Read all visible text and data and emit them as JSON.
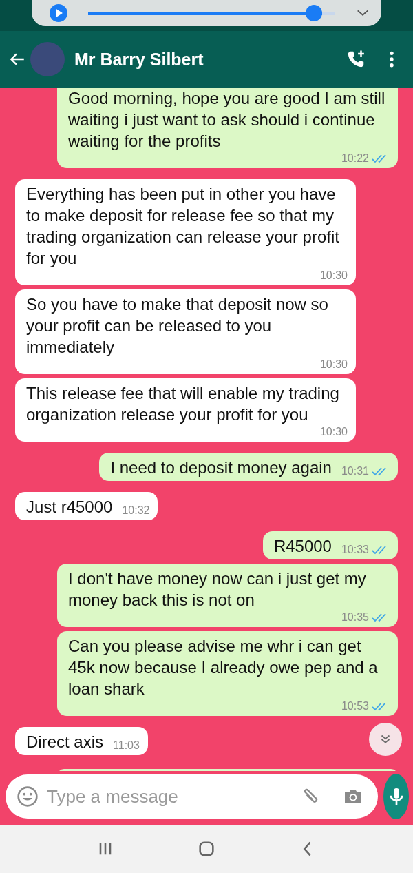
{
  "media_overlay": {
    "level": 0.95
  },
  "header": {
    "contact_name": "Mr Barry Silbert"
  },
  "messages": [
    {
      "kind": "sent",
      "text": "Good morning, hope you are good I am still waiting i just want to ask should i continue waiting for the profits",
      "time": "10:22",
      "read": true
    },
    {
      "kind": "received",
      "text": "Everything has been put in other you have to make deposit for release fee so that my trading organization can release your profit for you",
      "time": "10:30"
    },
    {
      "kind": "received",
      "text": "So you have to make that deposit now so your profit can be released to you immediately",
      "time": "10:30"
    },
    {
      "kind": "received",
      "text": "This release fee that will enable my trading organization release your profit for you",
      "time": "10:30"
    },
    {
      "kind": "sent",
      "text": "I need to deposit money again",
      "time": "10:31",
      "read": true
    },
    {
      "kind": "received",
      "text": "Just r45000",
      "time": "10:32"
    },
    {
      "kind": "sent",
      "text": "R45000",
      "time": "10:33",
      "read": true
    },
    {
      "kind": "sent",
      "text": "I don't have money now can i just get my money back this is not on",
      "time": "10:35",
      "read": true
    },
    {
      "kind": "sent",
      "text": "Can you please advise me whr i can get 45k now because I already owe pep and a loan shark",
      "time": "10:53",
      "read": true
    },
    {
      "kind": "received",
      "text": "Direct axis",
      "time": "11:03"
    }
  ],
  "composer": {
    "placeholder": "Type a message"
  }
}
